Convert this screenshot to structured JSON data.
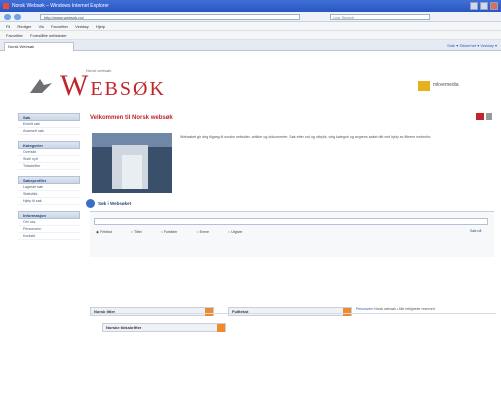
{
  "browser": {
    "window_title": "Norsk Websøk – Windows Internet Explorer",
    "url": "http://www.websok.no/",
    "search_placeholder": "Live Search",
    "menu": [
      "Fil",
      "Rediger",
      "Vis",
      "Favoritter",
      "Verktøy",
      "Hjelp"
    ],
    "favorites": [
      "Favoritter",
      "Foreslåtte nettsteder"
    ],
    "tab_label": "Norsk Websøk",
    "tools_label": "Side ▾  Sikkerhet ▾  Verktøy ▾"
  },
  "header": {
    "brand_first": "W",
    "brand_rest": "EBSØK",
    "brand_sub": "Norsk websøk",
    "partner": "mkvemedia"
  },
  "sidebar": {
    "sections": [
      {
        "head": "Søk",
        "items": [
          "Enkelt søk",
          "Avansert søk"
        ]
      },
      {
        "head": "Kategorier",
        "items": [
          "Oversikt",
          "Siste nytt",
          "Tidsskrifter"
        ]
      },
      {
        "head": "Søkeprofiler",
        "items": [
          "Lagrede søk",
          "Statistikk",
          "Hjelp til søk"
        ]
      },
      {
        "head": "Informasjon",
        "items": [
          "Om oss",
          "Personvern",
          "Kontakt"
        ]
      }
    ]
  },
  "content": {
    "welcome": "Velkommen til Norsk websøk",
    "intro": "Websøket gir deg tilgang til norske nettsider, artikler og dokumenter. Søk etter ord og uttrykk, velg kategori og avgrens søket ditt ved hjelp av filtrene nedenfor.",
    "search_title": "Søk i Websøket",
    "radios": [
      "Fritekst",
      "Tittel",
      "Forfatter",
      "Emne",
      "Utgiver"
    ],
    "search_button": "Søk nå",
    "drops": [
      "Norsk titler",
      "Fulltekst",
      "Norske tidsskrifter"
    ]
  },
  "footer": {
    "link": "Personvern",
    "text": "Norsk websøk • Alle rettigheter reservert"
  }
}
